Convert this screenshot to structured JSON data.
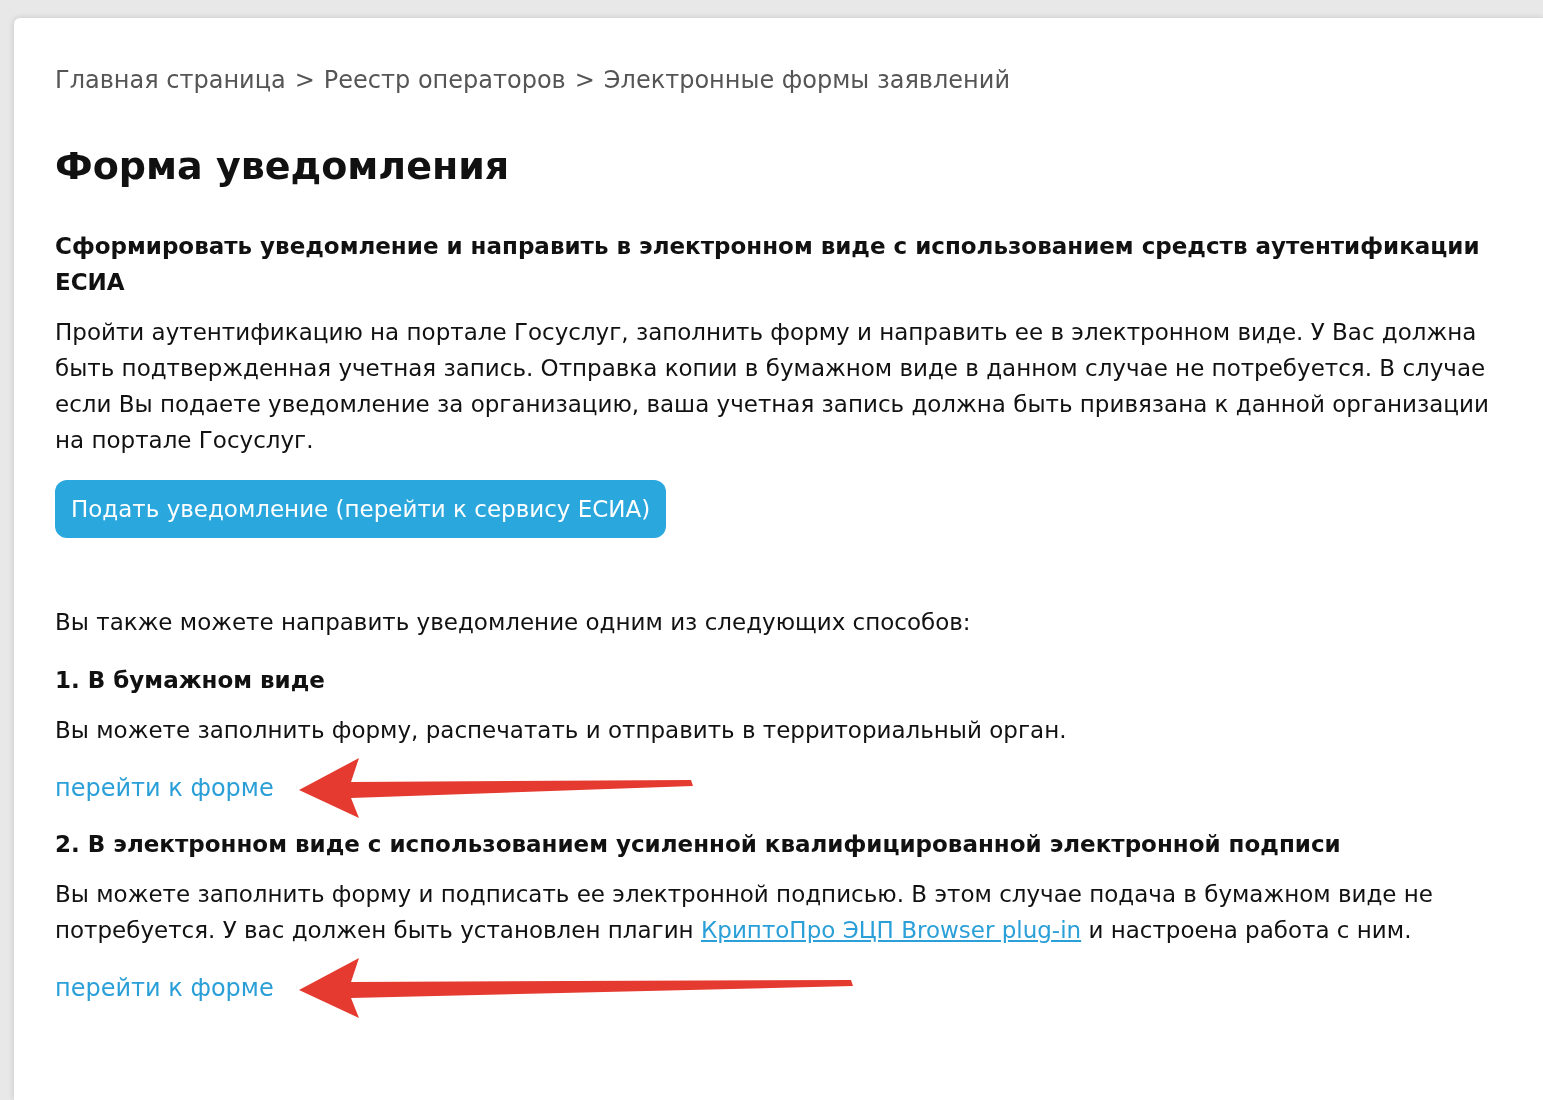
{
  "breadcrumb": {
    "separator": ">",
    "items": [
      {
        "label": "Главная страница"
      },
      {
        "label": "Реестр операторов"
      },
      {
        "label": "Электронные формы заявлений"
      }
    ]
  },
  "title": "Форма уведомления",
  "esia": {
    "heading": "Сформировать уведомление и направить в электронном виде с использованием средств аутентификации ЕСИА",
    "text": "Пройти аутентификацию на портале Госуслуг, заполнить форму и направить ее в электронном виде. У Вас должна быть подтвержденная учетная запись. Отправка копии в бумажном виде в данном случае не потребуется. В случае если Вы подаете уведомление за организацию, ваша учетная запись должна быть привязана к данной организации на портале Госуслуг.",
    "button": "Подать уведомление (перейти к сервису ЕСИА)"
  },
  "alternatives": {
    "intro": "Вы также можете направить уведомление одним из следующих способов:",
    "methods": [
      {
        "heading": "1. В бумажном виде",
        "text": "Вы можете заполнить форму, распечатать и отправить в территориальный орган.",
        "link": "перейти к форме",
        "arrow": true
      },
      {
        "heading": "2. В электронном виде с использованием усиленной квалифицированной электронной подписи",
        "text": "Вы можете заполнить форму и подписать ее электронной подписью. В этом случае подача в бумажном виде не потребуется. У вас должен быть установлен плагин",
        "inline_link": "КриптоПро ЭЦП Browser plug-in",
        "text_after": "и настроена работа с ним.",
        "link": "перейти к форме",
        "arrow": true
      }
    ]
  }
}
